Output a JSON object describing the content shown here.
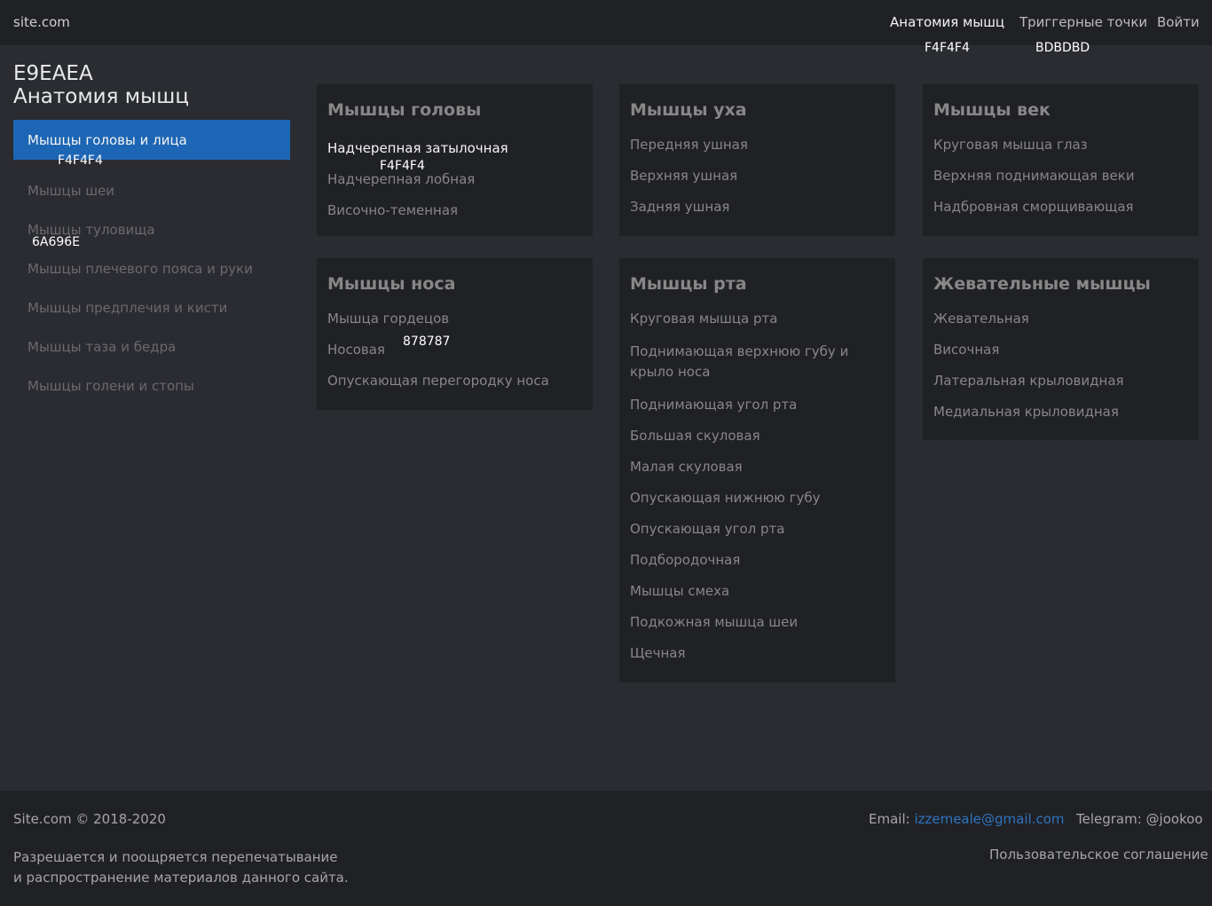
{
  "header": {
    "brand": "site.com",
    "nav": [
      "Анатомия мышц",
      "Триггерные точки",
      "Войти"
    ],
    "annotations": [
      "F4F4F4",
      "BDBDBD"
    ]
  },
  "sidebar": {
    "title_line1": "E9EAEA",
    "title_line2": "Анатомия мышц",
    "active_item": "Мышцы головы и лица",
    "active_annotation": "F4F4F4",
    "items": [
      "Мышцы шеи",
      "Мышцы туловища",
      "Мышцы плечевого пояса  и руки",
      "Мышцы предплечия и кисти",
      "Мышцы таза и бедра",
      "Мышцы голени и стопы"
    ],
    "items_annotation": "6A696E"
  },
  "cards": [
    {
      "title": "Мышцы головы",
      "items": [
        "Надчерепная затылочная",
        "Надчерепная лобная",
        "Височно-теменная"
      ],
      "annotation": "F4F4F4"
    },
    {
      "title": "Мышцы уха",
      "items": [
        "Передняя ушная",
        "Верхняя ушная",
        "Задняя ушная"
      ]
    },
    {
      "title": "Мышцы век",
      "items": [
        "Круговая мышца глаз",
        "Верхняя поднимающая веки",
        "Надбровная сморщивающая"
      ]
    },
    {
      "title": "Мышцы носа",
      "items": [
        "Мышца гордецов",
        "Носовая",
        "Опускающая перегородку носа"
      ],
      "annotation": "878787"
    },
    {
      "title": "Мышцы рта",
      "items": [
        "Круговая мышца рта",
        "Поднимающая верхнюю губу и крыло носа",
        "Поднимающая угол рта",
        "Большая скуловая",
        "Малая скуловая",
        "Опускающая нижнюю губу",
        "Опускающая угол рта",
        "Подбородочная",
        "Мышцы смеха",
        "Подкожная мышца шеи",
        "Щечная"
      ]
    },
    {
      "title": "Жевательные мышцы",
      "items": [
        "Жевательная",
        "Височная",
        "Латеральная крыловидная",
        "Медиальная крыловидная"
      ]
    }
  ],
  "footer": {
    "copyright": "Site.com © 2018-2020",
    "note_line1": "Разрешается и поощряется перепечатывание",
    "note_line2": "и распространение материалов данного сайта.",
    "email_label": "Email:",
    "email": "izzemeale@gmail.com",
    "telegram": "Telegram: @jookoo",
    "agreement": "Пользовательское соглашение"
  },
  "colors": {
    "page_bg": "#2a2c31",
    "panel_bg": "#202125",
    "accent": "#1d66b5",
    "link": "#2f74c0",
    "muted_text": "#878787",
    "sidebar_text": "#6a696e"
  }
}
